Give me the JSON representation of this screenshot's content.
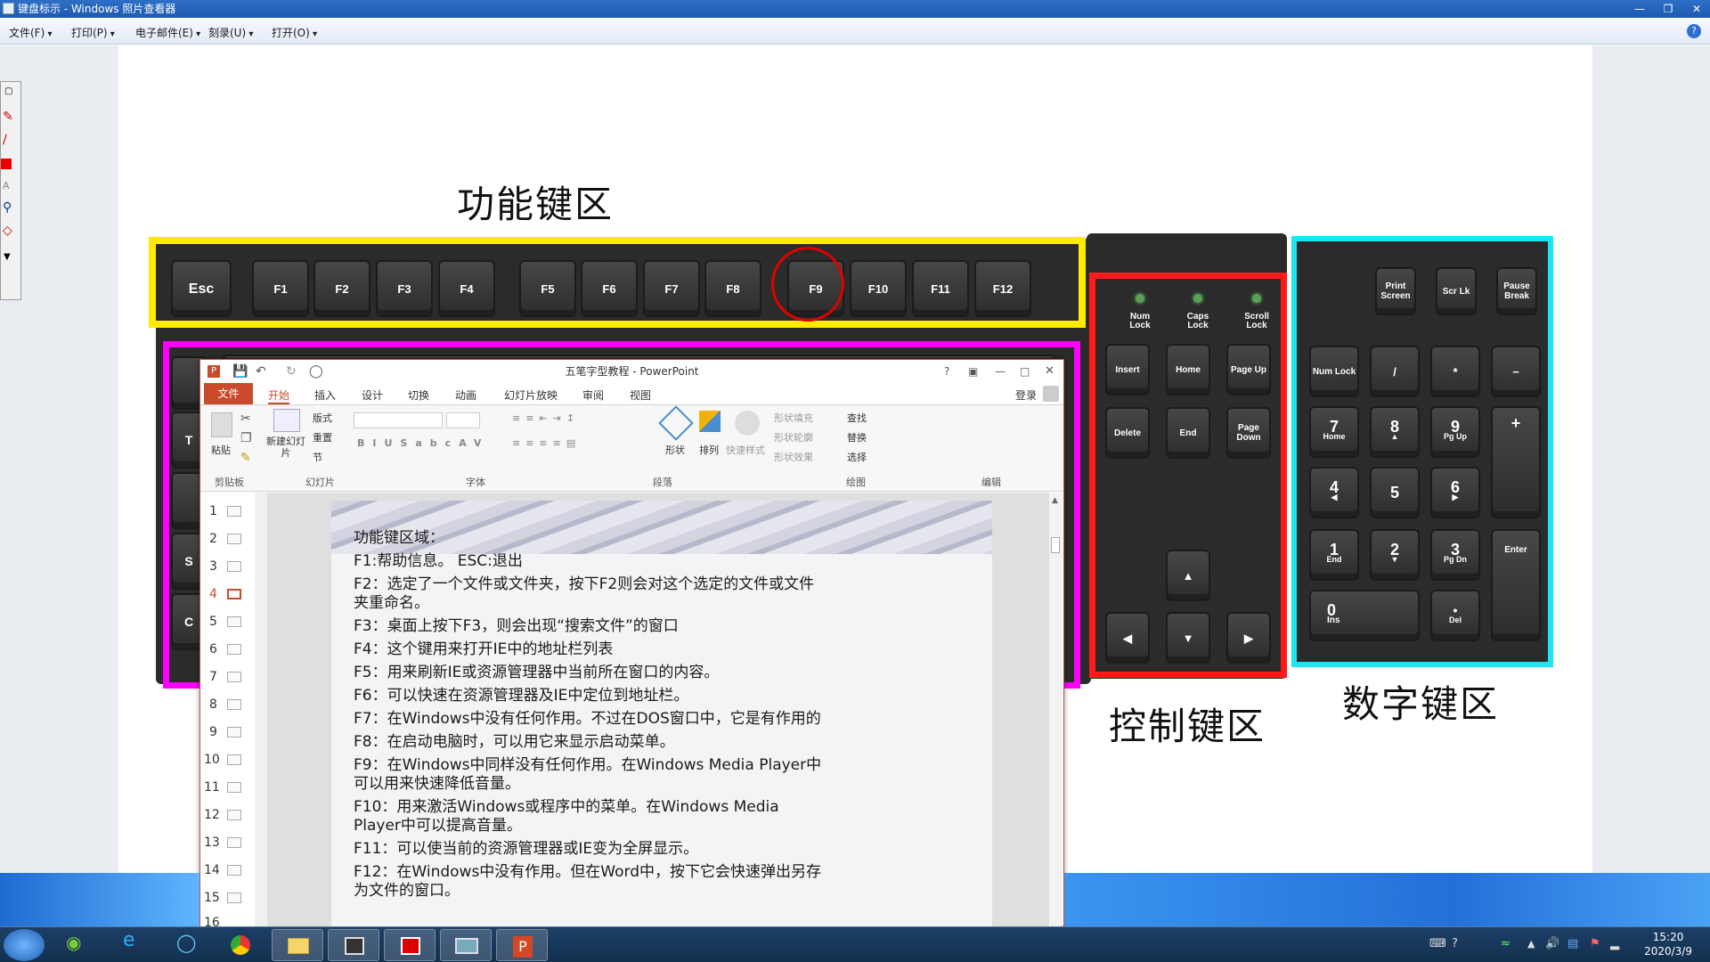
{
  "window": {
    "title": "键盘标示 - Windows 照片查看器"
  },
  "menu": {
    "file": "文件(F)",
    "print": "打印(P)",
    "email": "电子邮件(E)",
    "burn": "刻录(U)",
    "open": "打开(O)"
  },
  "headings": {
    "function_zone": "功能键区",
    "control_zone": "控制键区",
    "numpad_zone": "数字键区"
  },
  "keys": {
    "fn": [
      "Esc",
      "F1",
      "F2",
      "F3",
      "F4",
      "F5",
      "F6",
      "F7",
      "F8",
      "F9",
      "F10",
      "F11",
      "F12"
    ],
    "leds": [
      "Num Lock",
      "Caps Lock",
      "Scroll Lock"
    ],
    "system": [
      "Print Screen",
      "Scr Lk",
      "Pause Break"
    ],
    "nav": [
      "Insert",
      "Home",
      "Page Up",
      "Delete",
      "End",
      "Page Down"
    ],
    "arrows": [
      "▲",
      "◀",
      "▼",
      "▶"
    ],
    "numpad": [
      "Num Lock",
      "/",
      "*",
      "−",
      "7",
      "Home",
      "8",
      "▲",
      "9",
      "Pg Up",
      "+",
      "4",
      "◀",
      "5",
      "6",
      "▶",
      "1",
      "End",
      "2",
      "▼",
      "3",
      "Pg Dn",
      "Enter",
      "0",
      "Ins",
      "•",
      "Del"
    ]
  },
  "zone_colors": {
    "function": "#ffeb00",
    "typing": "#ff00ff",
    "control": "#ff1a1a",
    "numpad": "#19e6f0",
    "f9_circle": "#e00000"
  },
  "ppt": {
    "title": "五笔字型教程 - PowerPoint",
    "signin": "登录",
    "title_icons": [
      "?",
      "restore-ribbon",
      "minimize",
      "maximize",
      "close"
    ],
    "tabs": [
      "文件",
      "开始",
      "插入",
      "设计",
      "切换",
      "动画",
      "幻灯片放映",
      "审阅",
      "视图"
    ],
    "ribbon": {
      "paste": "粘贴",
      "new_slide": "新建幻灯片",
      "layout": "版式",
      "reset": "重置",
      "section": "节",
      "shape": "形状",
      "arrange": "排列",
      "quick_style": "快速样式",
      "fill": "形状填充",
      "outline": "形状轮廓",
      "effect": "形状效果",
      "find": "查找",
      "replace": "替换",
      "select": "选择",
      "groups": [
        "剪贴板",
        "幻灯片",
        "字体",
        "段落",
        "绘图",
        "编辑"
      ]
    },
    "slide_numbers": [
      "1",
      "2",
      "3",
      "4",
      "5",
      "6",
      "7",
      "8",
      "9",
      "10",
      "11",
      "12",
      "13",
      "14",
      "15",
      "16"
    ],
    "slide_lines": [
      "功能键区域：",
      "F1:帮助信息。 ESC:退出",
      "F2：选定了一个文件或文件夹，按下F2则会对这个选定的文件或文件夹重命名。",
      "F3：桌面上按下F3，则会出现“搜索文件”的窗口",
      "F4：这个键用来打开IE中的地址栏列表",
      "F5：用来刷新IE或资源管理器中当前所在窗口的内容。",
      "F6：可以快速在资源管理器及IE中定位到地址栏。",
      "F7：在Windows中没有任何作用。不过在DOS窗口中，它是有作用的",
      "F8：在启动电脑时，可以用它来显示启动菜单。",
      "F9：在Windows中同样没有任何作用。在Windows Media Player中可以用来快速降低音量。",
      "F10：用来激活Windows或程序中的菜单。在Windows Media Player中可以提高音量。",
      "F11：可以使当前的资源管理器或IE变为全屏显示。",
      "F12：在Windows中没有作用。但在Word中，按下它会快速弹出另存为文件的窗口。"
    ]
  },
  "taskbar": {
    "time": "15:20",
    "date": "2020/3/9",
    "apps": [
      "start",
      "360-browser",
      "ie",
      "ie-alt",
      "chrome",
      "explorer",
      "camera",
      "recorder",
      "photo-viewer",
      "powerpoint"
    ]
  }
}
